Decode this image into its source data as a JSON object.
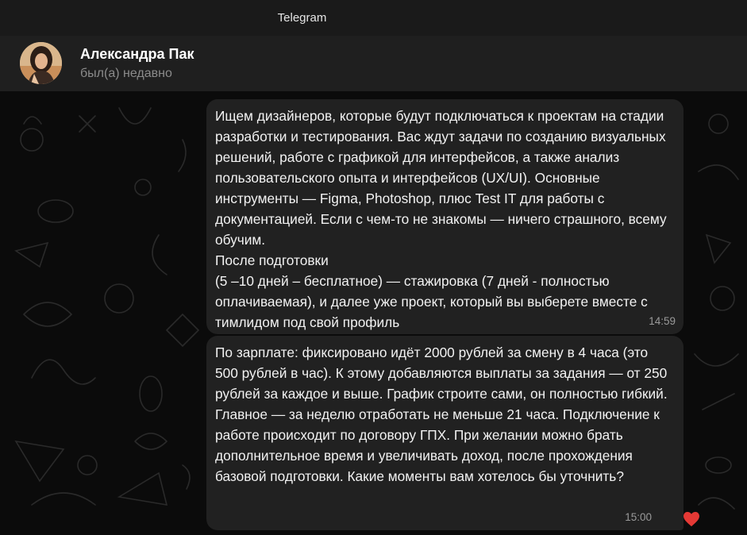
{
  "window": {
    "title": "Telegram"
  },
  "header": {
    "contact_name": "Александра Пак",
    "contact_status": "был(а) недавно",
    "avatar_icon": "profile-photo"
  },
  "messages": [
    {
      "text": "Ищем дизайнеров, которые будут подключаться к проектам на стадии разработки и тестирования. Вас ждут задачи по созданию визуальных решений, работе с графикой для интерфейсов, а также анализ пользовательского опыта и интерфейсов (UX/UI). Основные инструменты — Figma, Photoshop, плюс Test IT для работы с документацией. Если с чем-то не знакомы — ничего страшного, всему обучим.\nПосле подготовки\n(5 –10 дней – бесплатное) — стажировка (7 дней - полностью оплачиваемая), и далее уже проект, который вы выберете вместе с тимлидом под свой профиль",
      "time": "14:59"
    },
    {
      "text": "По зарплате: фиксировано идёт 2000 рублей за смену в 4 часа (это 500 рублей в час). К этому добавляются выплаты за задания — от 250 рублей за каждое и выше. График строите сами, он полностью гибкий. Главное — за неделю отработать не меньше 21 часа. Подключение к работе происходит по договору ГПХ. При желании можно брать дополнительное время и увеличивать доход, после прохождения базовой подготовки. Какие моменты вам хотелось бы уточнить?",
      "time": "15:00",
      "reaction": "❤️"
    }
  ],
  "colors": {
    "background": "#0b0b0b",
    "bubble": "#212121",
    "header": "#1f1f1f",
    "reaction_heart": "#e53935"
  }
}
